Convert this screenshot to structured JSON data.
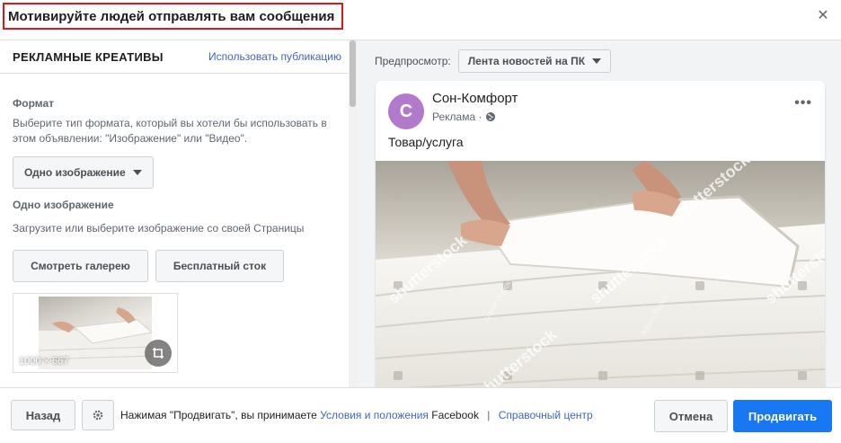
{
  "dialog": {
    "title": "Мотивируйте людей отправлять вам сообщения"
  },
  "left_panel": {
    "header": "РЕКЛАМНЫЕ КРЕАТИВЫ",
    "use_post_link": "Использовать публикацию",
    "format": {
      "title": "Формат",
      "description": "Выберите тип формата, который вы хотели бы использовать в этом объявлении: \"Изображение\" или \"Видео\".",
      "selected": "Одно изображение"
    },
    "single_image": {
      "title": "Одно изображение",
      "description": "Загрузите или выберите изображение со своей Страницы",
      "gallery_button": "Смотреть галерею",
      "stock_button": "Бесплатный сток",
      "thumbnail_size": "1000 × 667"
    }
  },
  "preview": {
    "label": "Предпросмотр:",
    "placement": "Лента новостей на ПК",
    "post": {
      "avatar_letter": "С",
      "page_name": "Сон-Комфорт",
      "sponsored": "Реклама ·",
      "text": "Товар/услуга",
      "watermark": "shutterstock",
      "photographer": "Artem Popov"
    }
  },
  "footer": {
    "back_button": "Назад",
    "terms_prefix": "Нажимая \"Продвигать\", вы принимаете",
    "terms_link": "Условия и положения",
    "terms_suffix": "Facebook",
    "separator": "|",
    "help_link": "Справочный центр",
    "cancel_button": "Отмена",
    "promote_button": "Продвигать"
  },
  "colors": {
    "accent": "#1877f2",
    "link": "#4267b2",
    "highlight_border": "#e0161f",
    "avatar": "#b17acb"
  }
}
